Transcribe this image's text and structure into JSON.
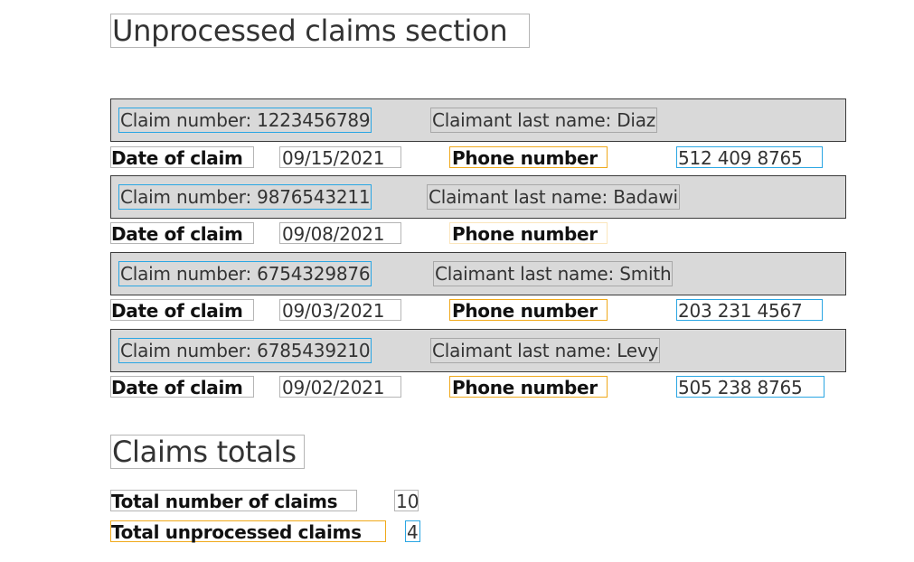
{
  "unprocessed_section": {
    "title": "Unprocessed claims section",
    "date_label": "Date of claim",
    "phone_label": "Phone number",
    "claims": [
      {
        "claim_number": "Claim number: 1223456789",
        "last_name": "Claimant last name: Diaz",
        "date": "09/15/2021",
        "phone": "512 409 8765"
      },
      {
        "claim_number": "Claim number: 9876543211",
        "last_name": "Claimant last name: Badawi",
        "date": "09/08/2021",
        "phone": ""
      },
      {
        "claim_number": "Claim number: 6754329876",
        "last_name": "Claimant last name: Smith",
        "date": "09/03/2021",
        "phone": "203 231 4567"
      },
      {
        "claim_number": "Claim number: 6785439210",
        "last_name": "Claimant last name: Levy",
        "date": "09/02/2021",
        "phone": "505 238 8765"
      }
    ]
  },
  "totals_section": {
    "title": "Claims totals",
    "total_claims_label": "Total number of claims",
    "total_claims_value": "10",
    "total_unprocessed_label": "Total unprocessed claims",
    "total_unprocessed_value": "4"
  },
  "colors": {
    "header_background": "#d9d9d9",
    "highlight_blue": "#2aa6e3",
    "highlight_orange": "#f0a91b"
  }
}
